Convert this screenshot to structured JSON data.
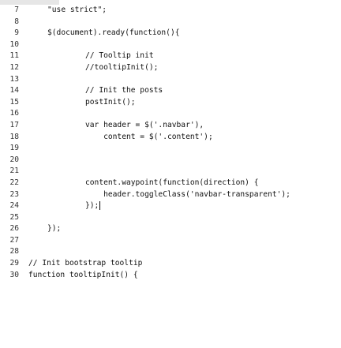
{
  "editor": {
    "lines": [
      {
        "n": "7",
        "text": "\"use strict\";",
        "indent": 1
      },
      {
        "n": "8",
        "text": "",
        "indent": 0
      },
      {
        "n": "9",
        "text": "$(document).ready(function(){",
        "indent": 1
      },
      {
        "n": "10",
        "text": "",
        "indent": 0
      },
      {
        "n": "11",
        "text": "// Tooltip init",
        "indent": 2
      },
      {
        "n": "12",
        "text": "//tooltipInit();",
        "indent": 2
      },
      {
        "n": "13",
        "text": "",
        "indent": 0
      },
      {
        "n": "14",
        "text": "// Init the posts",
        "indent": 2
      },
      {
        "n": "15",
        "text": "postInit();",
        "indent": 2
      },
      {
        "n": "16",
        "text": "",
        "indent": 0
      },
      {
        "n": "17",
        "text": "var header = $('.navbar'),",
        "indent": 2
      },
      {
        "n": "18",
        "text": "    content = $('.content');",
        "indent": 2
      },
      {
        "n": "19",
        "text": "",
        "indent": 0
      },
      {
        "n": "20",
        "text": "",
        "indent": 0
      },
      {
        "n": "21",
        "text": "",
        "indent": 0
      },
      {
        "n": "22",
        "text": "content.waypoint(function(direction) {",
        "indent": 2
      },
      {
        "n": "23",
        "text": "    header.toggleClass('navbar-transparent');",
        "indent": 2
      },
      {
        "n": "24",
        "text": "});",
        "indent": 2,
        "caret": true
      },
      {
        "n": "25",
        "text": "",
        "indent": 0
      },
      {
        "n": "26",
        "text": "});",
        "indent": 1
      },
      {
        "n": "27",
        "text": "",
        "indent": 0
      },
      {
        "n": "28",
        "text": "",
        "indent": 0
      },
      {
        "n": "29",
        "text": "// Init bootstrap tooltip",
        "indent": 0
      },
      {
        "n": "30",
        "text": "function tooltipInit() {",
        "indent": 0
      }
    ]
  }
}
